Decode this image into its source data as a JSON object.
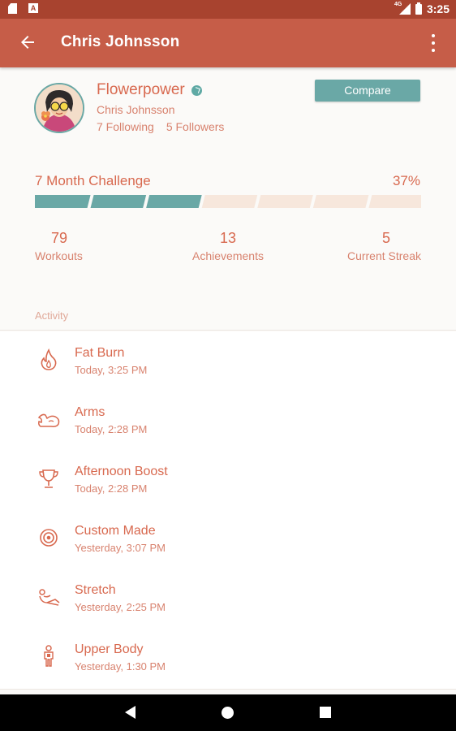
{
  "status_bar": {
    "time": "3:25",
    "network": "4G",
    "colors": {
      "bar": "#a8432f"
    }
  },
  "app_bar": {
    "title": "Chris Johnsson",
    "back_icon": "arrow-back-icon",
    "menu_icon": "more-vert-icon",
    "color": "#c65d48"
  },
  "profile": {
    "username": "Flowerpower",
    "real_name": "Chris Johnsson",
    "following": "7 Following",
    "followers": "5 Followers",
    "compare_label": "Compare",
    "accent": "#6aa8a6"
  },
  "challenge": {
    "title": "7 Month Challenge",
    "percent_label": "37%",
    "segments_total": 7,
    "segments_filled": 3,
    "progress": 0.37
  },
  "stats": [
    {
      "value": "79",
      "label": "Workouts"
    },
    {
      "value": "13",
      "label": "Achievements"
    },
    {
      "value": "5",
      "label": "Current Streak"
    }
  ],
  "activity": {
    "header": "Activity",
    "items": [
      {
        "name": "Fat Burn",
        "time": "Today, 3:25 PM",
        "icon": "flame-icon"
      },
      {
        "name": "Arms",
        "time": "Today, 2:28 PM",
        "icon": "arm-muscle-icon"
      },
      {
        "name": "Afternoon Boost",
        "time": "Today, 2:28 PM",
        "icon": "trophy-icon"
      },
      {
        "name": "Custom Made",
        "time": "Yesterday, 3:07 PM",
        "icon": "target-icon"
      },
      {
        "name": "Stretch",
        "time": "Yesterday, 2:25 PM",
        "icon": "stretch-icon"
      },
      {
        "name": "Upper Body",
        "time": "Yesterday, 1:30 PM",
        "icon": "body-icon"
      }
    ]
  }
}
